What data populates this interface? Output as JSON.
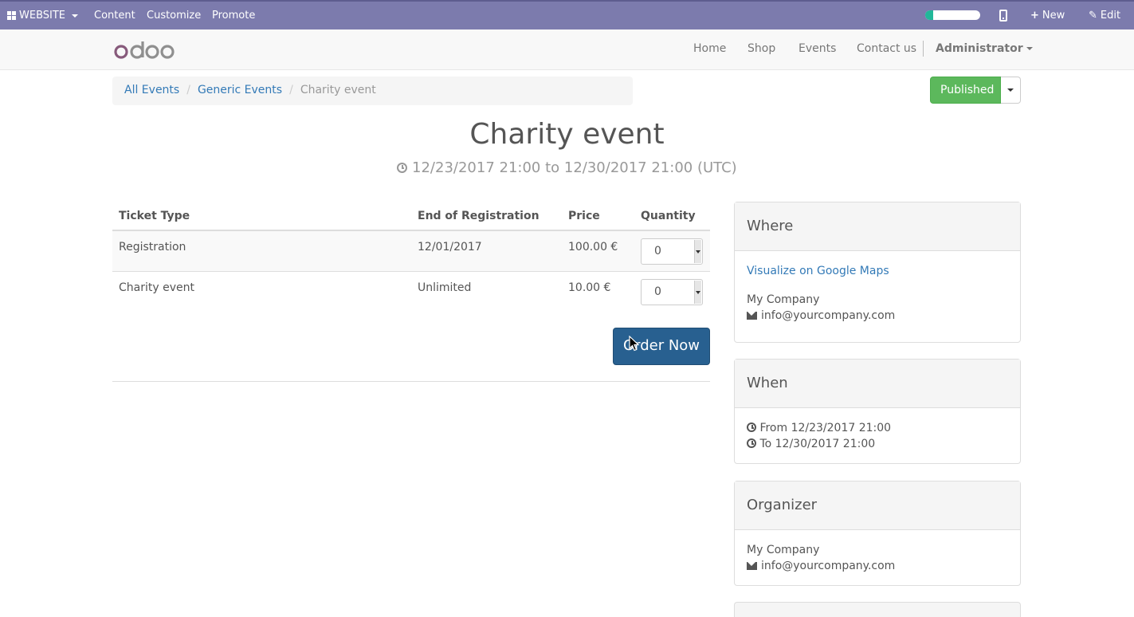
{
  "adminbar": {
    "apps_label": "WEBSITE",
    "menu": [
      "Content",
      "Customize",
      "Promote"
    ],
    "progress": 0.15,
    "new_label": "New",
    "edit_label": "Edit"
  },
  "navbar": {
    "logo_text": "odoo",
    "links": [
      "Home",
      "Shop",
      "Events",
      "Contact us"
    ],
    "user": "Administrator"
  },
  "breadcrumb": {
    "items": [
      "All Events",
      "Generic Events"
    ],
    "active": "Charity event"
  },
  "publish": {
    "label": "Published",
    "color": "#5cb85c"
  },
  "event": {
    "title": "Charity event",
    "dates": "12/23/2017 21:00 to 12/30/2017 21:00 (UTC)"
  },
  "tickets": {
    "headers": [
      "Ticket Type",
      "End of Registration",
      "Price",
      "Quantity"
    ],
    "rows": [
      {
        "type": "Registration",
        "end": "12/01/2017",
        "price": "100.00 €",
        "qty": "0"
      },
      {
        "type": "Charity event",
        "end": "Unlimited",
        "price": "10.00 €",
        "qty": "0"
      }
    ],
    "order_label": "Order Now"
  },
  "panels": {
    "where": {
      "title": "Where",
      "map_link": "Visualize on Google Maps",
      "company": "My Company",
      "email": "info@yourcompany.com"
    },
    "when": {
      "title": "When",
      "from": "From 12/23/2017 21:00",
      "to": "To 12/30/2017 21:00"
    },
    "organizer": {
      "title": "Organizer",
      "company": "My Company",
      "email": "info@yourcompany.com"
    }
  },
  "colors": {
    "adminbar": "#7c7bad",
    "primary": "#286090",
    "link": "#337ab7",
    "logo": "#875a7b"
  }
}
